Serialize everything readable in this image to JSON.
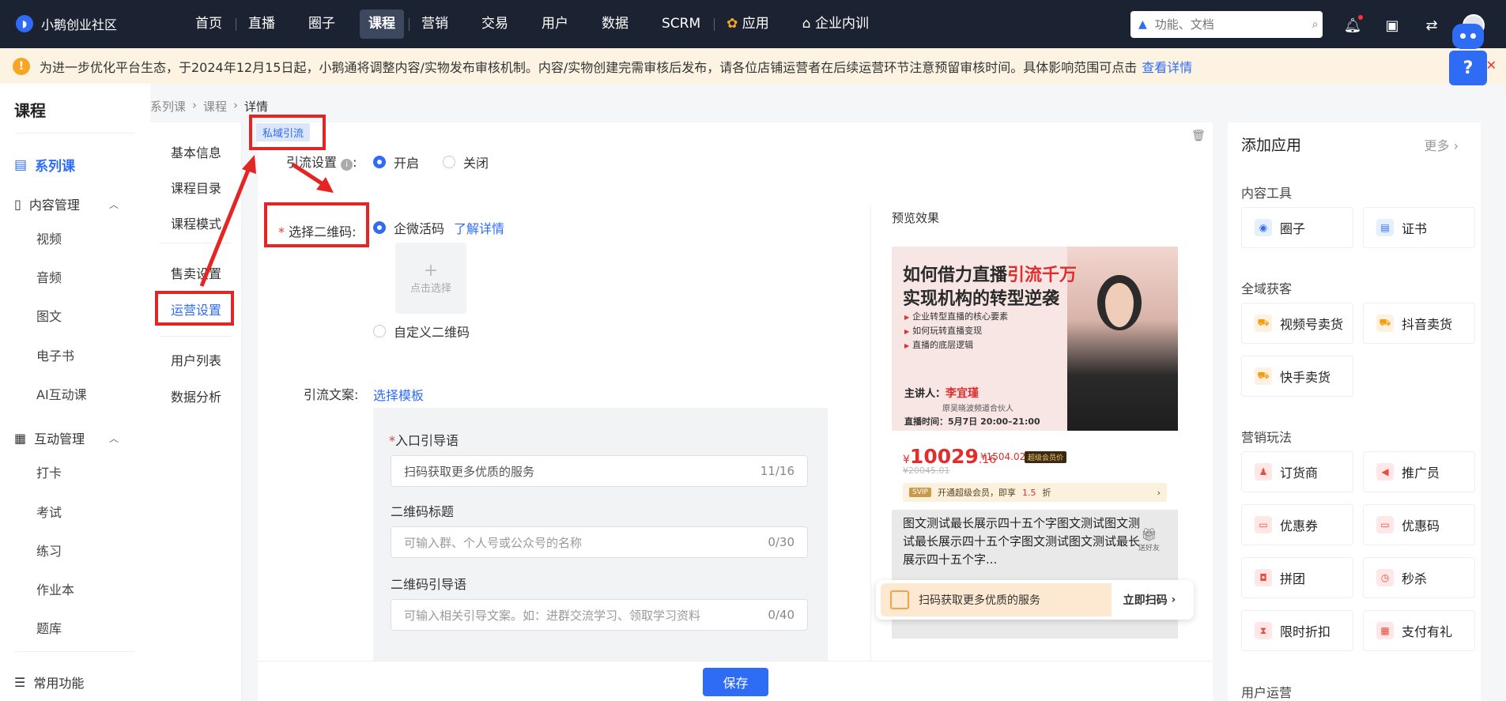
{
  "app": {
    "name": "小鹅创业社区"
  },
  "nav": {
    "items": [
      "首页",
      "直播",
      "圈子",
      "课程",
      "营销",
      "交易",
      "用户",
      "数据",
      "SCRM",
      "应用",
      "企业内训"
    ],
    "active": "课程"
  },
  "search": {
    "placeholder": "功能、文档"
  },
  "notice": {
    "text": "为进一步优化平台生态，于2024年12月15日起，小鹅通将调整内容/实物发布审核机制。内容/实物创建完需审核后发布，请各位店铺运营者在后续运营环节注意预留审核时间。具体影响范围可点击",
    "link": "查看详情"
  },
  "sidebar": {
    "title": "课程",
    "items": {
      "series": "系列课",
      "content_mgmt": "内容管理",
      "video": "视频",
      "audio": "音频",
      "article": "图文",
      "ebook": "电子书",
      "ai": "AI互动课",
      "interact_mgmt": "互动管理",
      "checkin": "打卡",
      "exam": "考试",
      "practice": "练习",
      "homework": "作业本",
      "question_bank": "题库",
      "common": "常用功能"
    }
  },
  "breadcrumb": [
    "系列课",
    "课程",
    "详情"
  ],
  "subnav": [
    "基本信息",
    "课程目录",
    "课程模式",
    "售卖设置",
    "运营设置",
    "用户列表",
    "数据分析"
  ],
  "form": {
    "tag": "私域引流",
    "traffic_label": "引流设置",
    "on": "开启",
    "off": "关闭",
    "qr_label": "选择二维码:",
    "wecom": "企微活码",
    "learn_more": "了解详情",
    "upload_text": "点击选择",
    "upload_plus": "+",
    "custom_qr": "自定义二维码",
    "copy_label": "引流文案:",
    "choose_template": "选择模板",
    "entry_label": "入口引导语",
    "entry_value": "扫码获取更多优质的服务",
    "entry_count": "11/16",
    "qr_title_label": "二维码标题",
    "qr_title_placeholder": "可输入群、个人号或公众号的名称",
    "qr_title_count": "0/30",
    "qr_guide_label": "二维码引导语",
    "qr_guide_placeholder": "可输入相关引导文案。如：进群交流学习、领取学习资料",
    "qr_guide_count": "0/40",
    "save": "保存"
  },
  "preview": {
    "label": "预览效果",
    "title1_a": "如何借力直播",
    "title1_b": "引流千万",
    "title2": "实现机构的转型逆袭",
    "bullets": [
      "企业转型直播的核心要素",
      "如何玩转直播变现",
      "直播的底层逻辑"
    ],
    "speaker_label": "主讲人：",
    "speaker": "李宜瑾",
    "speaker_desc": "原吴晓波频道合伙人",
    "time": "直播时间：5月7日 20:00–21:00",
    "currency": "¥",
    "price": "10029",
    "price_decimal": ".16",
    "member_price": "¥1504.02",
    "member_badge": "超级会员价",
    "original_price": "¥20045.01",
    "svip_tag": "SVIP",
    "svip_text": "开通超级会员，即享",
    "svip_discount": "1.5",
    "svip_unit": "折",
    "description": "图文测试最长展示四十五个字图文测试图文测试最长展示四十五个字图文测试图文测试最长展示四十五个字...",
    "gift_label": "送好友",
    "scan_text": "扫码获取更多优质的服务",
    "scan_button": "立即扫码"
  },
  "right_panel": {
    "title": "添加应用",
    "more": "更多",
    "sections": {
      "content_tools": "内容工具",
      "acquisition": "全域获客",
      "marketing": "营销玩法",
      "user_ops": "用户运营"
    },
    "apps": {
      "circle": "圈子",
      "certificate": "证书",
      "channels": "视频号卖货",
      "douyin": "抖音卖货",
      "kuaishou": "快手卖货",
      "order": "订货商",
      "promoter": "推广员",
      "coupon": "优惠券",
      "coupon_code": "优惠码",
      "group_buy": "拼团",
      "flash_sale": "秒杀",
      "limited_discount": "限时折扣",
      "pay_gift": "支付有礼"
    }
  },
  "colors": {
    "primary": "#2f6cf6",
    "topbar": "#1b2231",
    "annotation": "#e52424",
    "notice_bg": "#fdf3e3"
  }
}
